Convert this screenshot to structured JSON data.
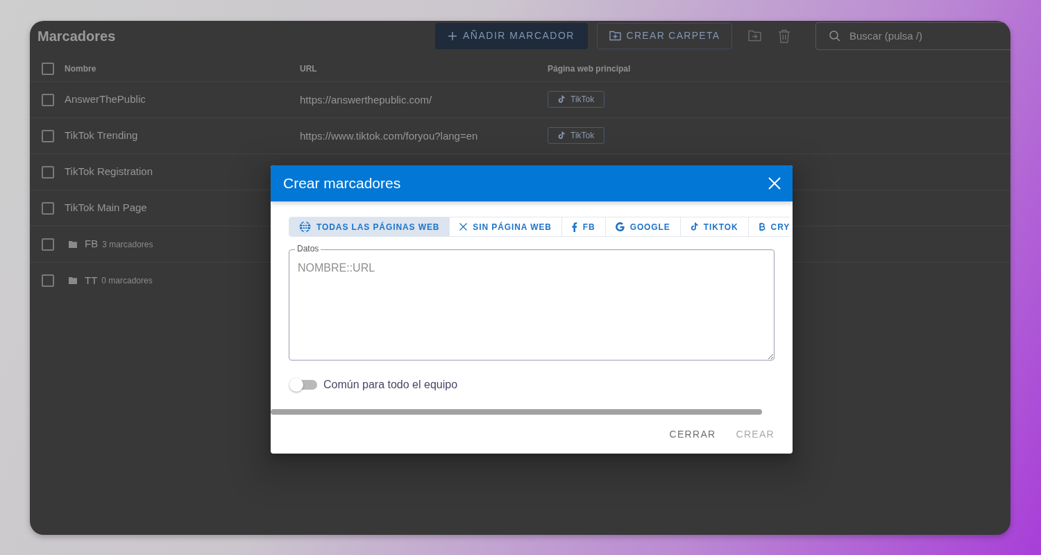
{
  "header": {
    "title": "Marcadores",
    "buttons": [
      {
        "kind": "primary",
        "label": "AÑADIR MARCADOR"
      },
      {
        "kind": "outline",
        "label": "CREAR CARPETA"
      }
    ],
    "search": {
      "placeholder": "Buscar (pulsa /)"
    }
  },
  "table": {
    "select_all_checked": false,
    "columns": [
      "Nombre",
      "URL",
      "Página web principal"
    ],
    "rows": [
      {
        "kind": "bookmark",
        "checked": false,
        "name": "AnswerThePublic",
        "url": "https://answerthepublic.com/",
        "site": "TikTok"
      },
      {
        "kind": "bookmark",
        "checked": false,
        "name": "TikTok Trending",
        "url": "https://www.tiktok.com/foryou?lang=en",
        "site": "TikTok"
      },
      {
        "kind": "bookmark",
        "checked": false,
        "name": "TikTok Registration"
      },
      {
        "kind": "bookmark",
        "checked": false,
        "name": "TikTok Main Page"
      },
      {
        "kind": "folder",
        "checked": false,
        "name": "FB",
        "count": "3 marcadores"
      },
      {
        "kind": "folder",
        "checked": false,
        "name": "TT",
        "count": "0 marcadores"
      }
    ]
  },
  "dialog": {
    "title": "Crear marcadores",
    "tabs": [
      {
        "label": "TODAS LAS PÁGINAS WEB",
        "selected": true
      },
      {
        "label": "SIN PÁGINA WEB",
        "selected": false
      },
      {
        "label": "FB",
        "selected": false
      },
      {
        "label": "GOOGLE",
        "selected": false
      },
      {
        "label": "TIKTOK",
        "selected": false
      },
      {
        "label": "CRY",
        "selected": false
      }
    ],
    "data_field": {
      "label": "Datos",
      "placeholder": "NOMBRE::URL"
    },
    "shared_toggle": {
      "label": "Común para todo el equipo",
      "on": false
    },
    "buttons": [
      {
        "label": "CERRAR",
        "disabled": false
      },
      {
        "label": "CREAR",
        "disabled": true
      }
    ]
  }
}
